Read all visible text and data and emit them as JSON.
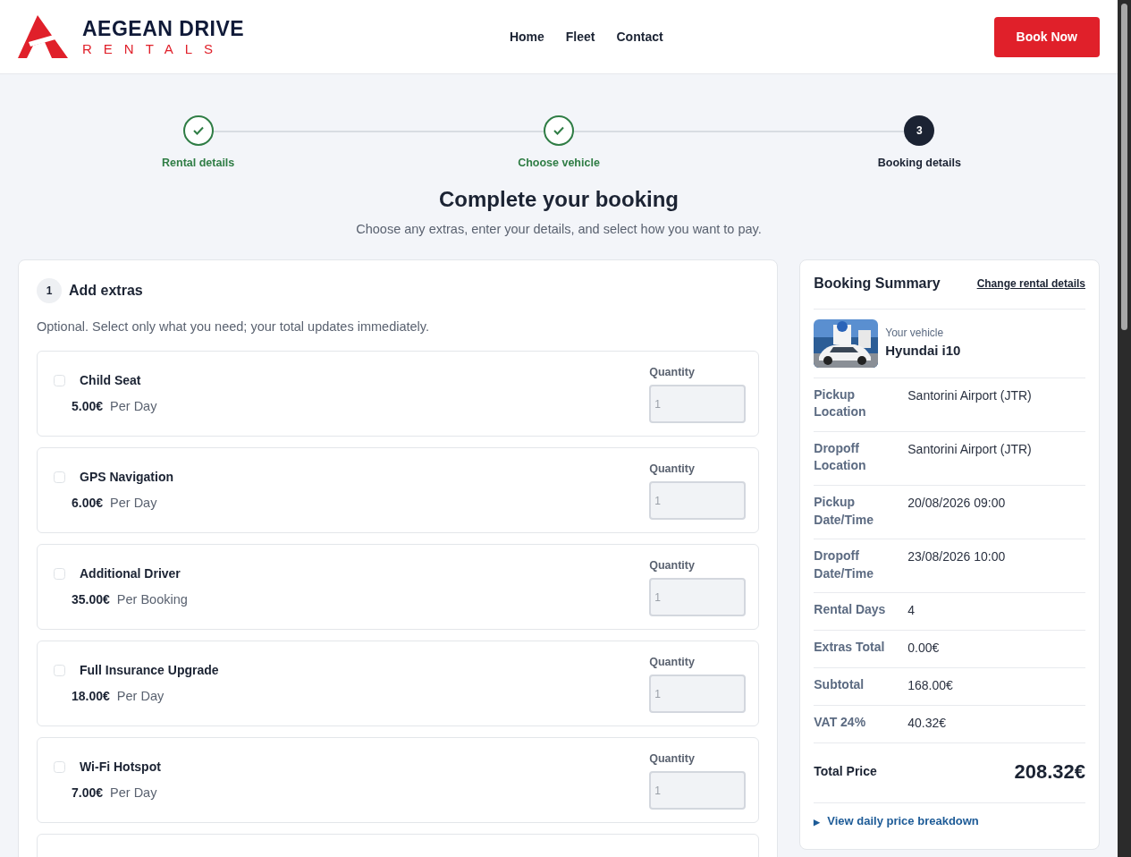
{
  "brand": {
    "name": "AEGEAN DRIVE",
    "tagline": "RENTALS"
  },
  "nav": [
    "Home",
    "Fleet",
    "Contact"
  ],
  "book_button": "Book Now",
  "steps": [
    {
      "label": "Rental details",
      "done": true
    },
    {
      "label": "Choose vehicle",
      "done": true
    },
    {
      "label": "Booking details",
      "done": false,
      "number": "3"
    }
  ],
  "heading": "Complete your booking",
  "subheading": "Choose any extras, enter your details, and select how you want to pay.",
  "extras_section": {
    "number": "1",
    "title": "Add extras",
    "hint": "Optional. Select only what you need; your total updates immediately.",
    "items": [
      {
        "name": "Child Seat",
        "price": "5.00€",
        "unit": "Per Day",
        "checked": false,
        "quantity_label": "Quantity",
        "quantity": "1",
        "disabled": true
      },
      {
        "name": "GPS Navigation",
        "price": "6.00€",
        "unit": "Per Day",
        "checked": false,
        "quantity_label": "Quantity",
        "quantity": "1",
        "disabled": true
      },
      {
        "name": "Additional Driver",
        "price": "35.00€",
        "unit": "Per Booking",
        "checked": false,
        "quantity_label": "Quantity",
        "quantity": "1",
        "disabled": true
      },
      {
        "name": "Full Insurance Upgrade",
        "price": "18.00€",
        "unit": "Per Day",
        "checked": false,
        "quantity_label": "Quantity",
        "quantity": "1",
        "disabled": true
      },
      {
        "name": "Wi-Fi Hotspot",
        "price": "7.00€",
        "unit": "Per Day",
        "checked": false,
        "quantity_label": "Quantity",
        "quantity": "1",
        "disabled": true
      }
    ]
  },
  "summary": {
    "title": "Booking Summary",
    "change_link": "Change rental details",
    "vehicle_label": "Your vehicle",
    "vehicle": "Hyundai i10",
    "rows": [
      {
        "label": "Pickup Location",
        "value": "Santorini Airport (JTR)"
      },
      {
        "label": "Dropoff Location",
        "value": "Santorini Airport (JTR)"
      },
      {
        "label": "Pickup Date/Time",
        "value": "20/08/2026 09:00"
      },
      {
        "label": "Dropoff Date/Time",
        "value": "23/08/2026 10:00"
      },
      {
        "label": "Rental Days",
        "value": "4"
      },
      {
        "label": "Extras Total",
        "value": "0.00€"
      },
      {
        "label": "Subtotal",
        "value": "168.00€"
      },
      {
        "label": "VAT 24%",
        "value": "40.32€"
      }
    ],
    "total_label": "Total Price",
    "total": "208.32€",
    "breakdown": {
      "marker": "▶",
      "label": "View daily price breakdown",
      "expanded": false
    }
  }
}
